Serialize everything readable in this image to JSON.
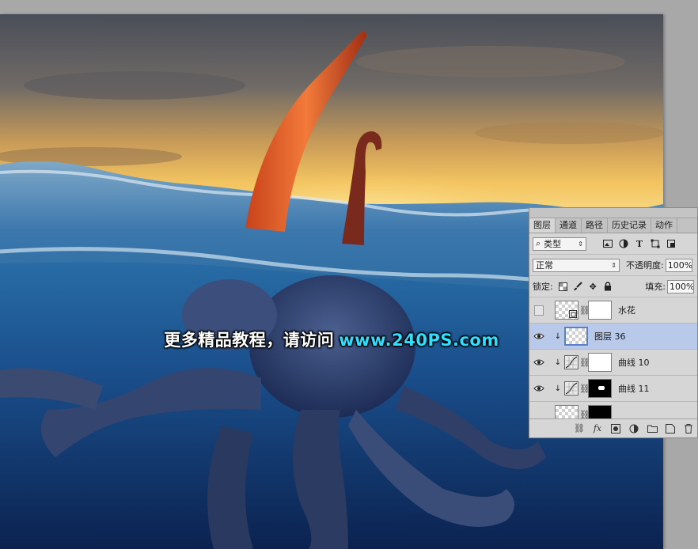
{
  "canvas": {
    "watermark": {
      "cn_text": "更多精品教程，请访问",
      "url": "www.240PS.com"
    }
  },
  "layers_panel": {
    "tabs": [
      {
        "label": "图层",
        "active": true
      },
      {
        "label": "通道",
        "active": false
      },
      {
        "label": "路径",
        "active": false
      },
      {
        "label": "历史记录",
        "active": false
      },
      {
        "label": "动作",
        "active": false
      }
    ],
    "filter": {
      "kind_label": "类型",
      "icons": [
        "image-filter-icon",
        "adjustment-filter-icon",
        "type-filter-icon",
        "shape-filter-icon",
        "smart-object-filter-icon"
      ]
    },
    "blend_mode": "正常",
    "opacity_label": "不透明度:",
    "opacity_value": "100%",
    "lock_label": "锁定:",
    "fill_label": "填充:",
    "fill_value": "100%",
    "layers": [
      {
        "name": "水花",
        "visible": false,
        "selected": false
      },
      {
        "name": "图层 36",
        "visible": true,
        "selected": true
      },
      {
        "name": "曲线 10",
        "visible": true,
        "selected": false
      },
      {
        "name": "曲线 11",
        "visible": true,
        "selected": false
      }
    ],
    "colors": {
      "selected_row": "#b8c9ea",
      "watermark_url": "#2de0ff"
    }
  }
}
